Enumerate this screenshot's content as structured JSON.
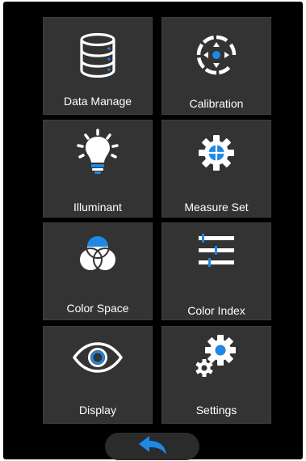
{
  "accent_color": "#1e88e5",
  "menu": {
    "items": [
      {
        "label": "Data Manage",
        "icon": "database-icon"
      },
      {
        "label": "Calibration",
        "icon": "calibration-target-icon"
      },
      {
        "label": "Illuminant",
        "icon": "light-bulb-icon"
      },
      {
        "label": "Measure Set",
        "icon": "measure-gear-icon"
      },
      {
        "label": "Color Space",
        "icon": "color-circles-icon"
      },
      {
        "label": "Color Index",
        "icon": "sliders-icon"
      },
      {
        "label": "Display",
        "icon": "eye-icon"
      },
      {
        "label": "Settings",
        "icon": "gears-icon"
      }
    ]
  },
  "footer": {
    "back_icon": "back-arrow-icon"
  }
}
